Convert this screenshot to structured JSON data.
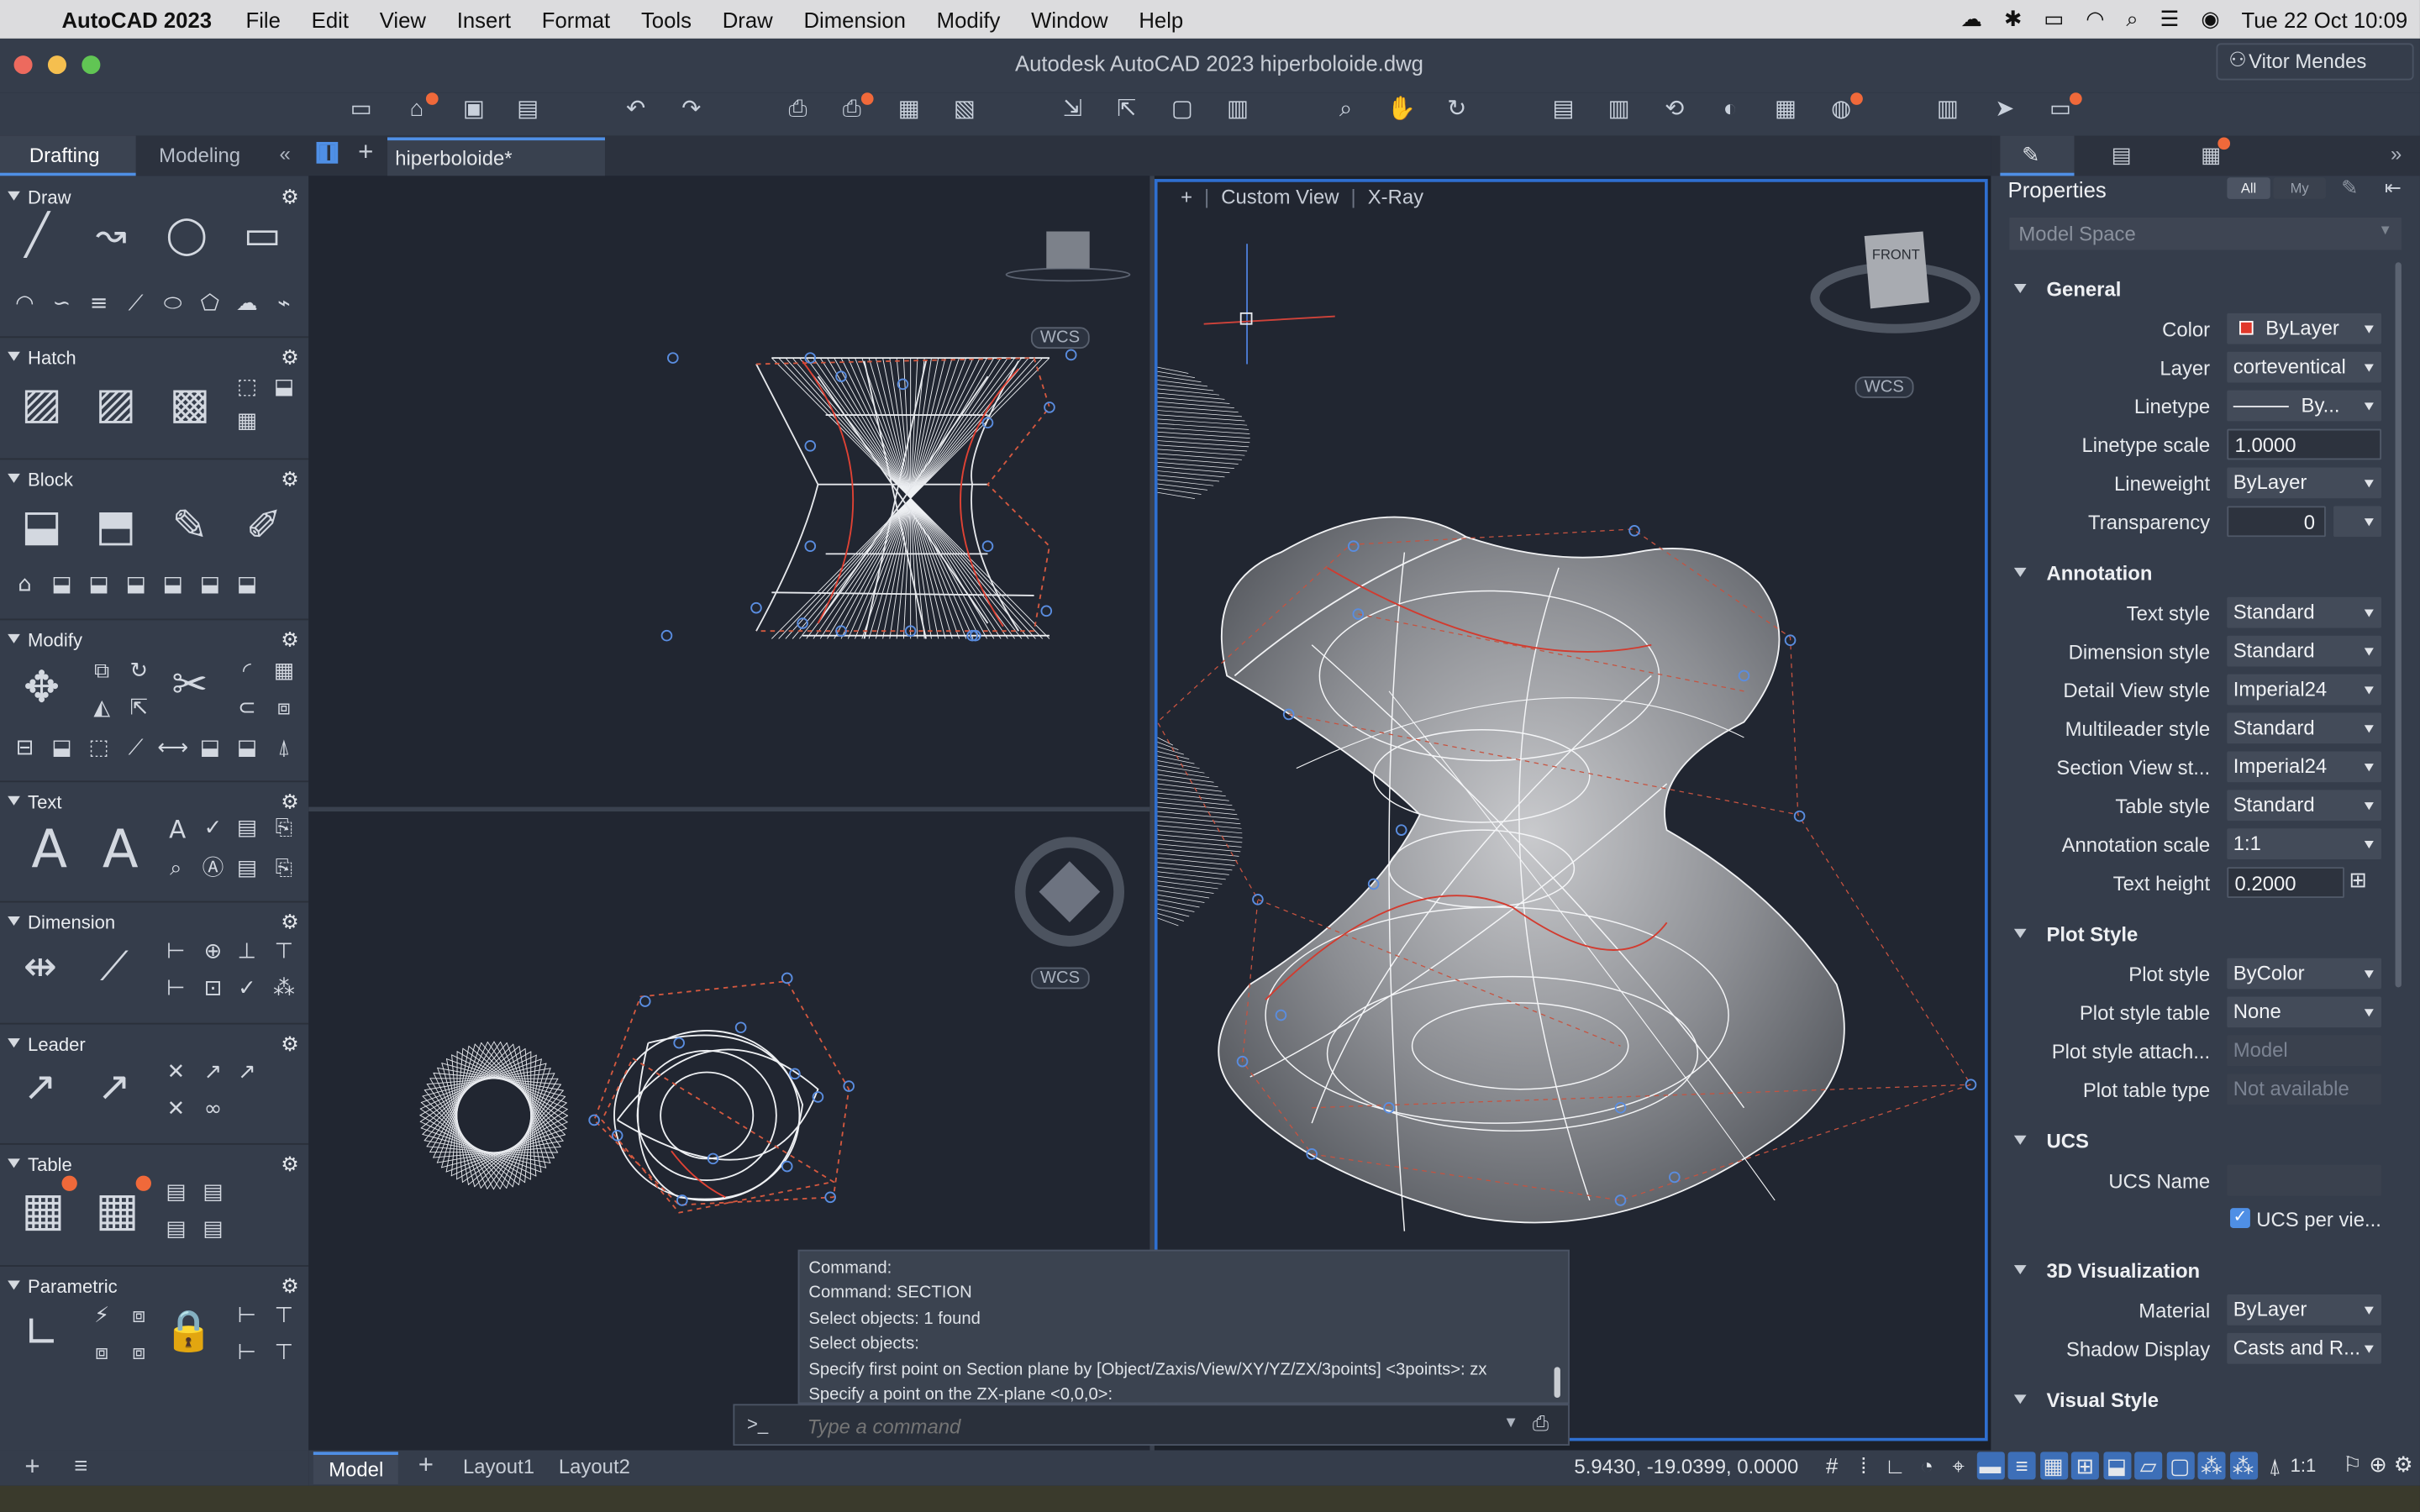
{
  "menubar": {
    "app_name": "AutoCAD 2023",
    "items": [
      "File",
      "Edit",
      "View",
      "Insert",
      "Format",
      "Tools",
      "Draw",
      "Dimension",
      "Modify",
      "Window",
      "Help"
    ],
    "datetime": "Tue 22 Oct  10:09"
  },
  "window": {
    "title": "Autodesk AutoCAD 2023    hiperboloide.dwg",
    "user": "Vitor Mendes"
  },
  "palette_tabs": {
    "drafting": "Drafting",
    "modeling": "Modeling"
  },
  "document_tab": "hiperboloide*",
  "tool_sections": {
    "draw": "Draw",
    "hatch": "Hatch",
    "block": "Block",
    "modify": "Modify",
    "text": "Text",
    "dimension": "Dimension",
    "leader": "Leader",
    "table": "Table",
    "parametric": "Parametric"
  },
  "viewport": {
    "plus": "+",
    "view": "Custom View",
    "style": "X-Ray",
    "wcs": "WCS",
    "viewcube_label": "FRONT"
  },
  "command": {
    "history": [
      "Command:",
      "Command: SECTION",
      "Select objects: 1 found",
      "Select objects:",
      "Specify first point on Section plane by [Object/Zaxis/View/XY/YZ/ZX/3points] <3points>: zx",
      "Specify a point on the ZX-plane <0,0,0>:"
    ],
    "prompt_icon": ">_",
    "placeholder": "Type a command"
  },
  "layout_tabs": [
    "Model",
    "Layout1",
    "Layout2"
  ],
  "status": {
    "coords": "5.9430, -19.0399, 0.0000",
    "scale": "1:1"
  },
  "properties": {
    "title": "Properties",
    "filter_all": "All",
    "filter_my": "My",
    "space": "Model Space",
    "sections": {
      "general": "General",
      "annotation": "Annotation",
      "plot_style": "Plot Style",
      "ucs": "UCS",
      "viz3d": "3D Visualization",
      "visual_style": "Visual Style"
    },
    "general": [
      {
        "label": "Color",
        "value": "ByLayer"
      },
      {
        "label": "Layer",
        "value": "corteventical"
      },
      {
        "label": "Linetype",
        "value": "By..."
      },
      {
        "label": "Linetype scale",
        "value": "1.0000"
      },
      {
        "label": "Lineweight",
        "value": "ByLayer"
      },
      {
        "label": "Transparency",
        "value": "0"
      }
    ],
    "annotation": [
      {
        "label": "Text style",
        "value": "Standard"
      },
      {
        "label": "Dimension style",
        "value": "Standard"
      },
      {
        "label": "Detail View style",
        "value": "Imperial24"
      },
      {
        "label": "Multileader style",
        "value": "Standard"
      },
      {
        "label": "Section View st...",
        "value": "Imperial24"
      },
      {
        "label": "Table style",
        "value": "Standard"
      },
      {
        "label": "Annotation scale",
        "value": "1:1"
      },
      {
        "label": "Text height",
        "value": "0.2000"
      }
    ],
    "plot_style": [
      {
        "label": "Plot style",
        "value": "ByColor"
      },
      {
        "label": "Plot style table",
        "value": "None"
      },
      {
        "label": "Plot style attach...",
        "value": "Model"
      },
      {
        "label": "Plot table type",
        "value": "Not available"
      }
    ],
    "ucs": [
      {
        "label": "UCS Name",
        "value": ""
      },
      {
        "label": "UCS per vie...",
        "value": ""
      }
    ],
    "viz3d": [
      {
        "label": "Material",
        "value": "ByLayer"
      },
      {
        "label": "Shadow Display",
        "value": "Casts and R..."
      }
    ]
  },
  "colors": {
    "accent": "#2f6fd0",
    "badge": "#f0693a",
    "red_swatch": "#e0382b"
  }
}
